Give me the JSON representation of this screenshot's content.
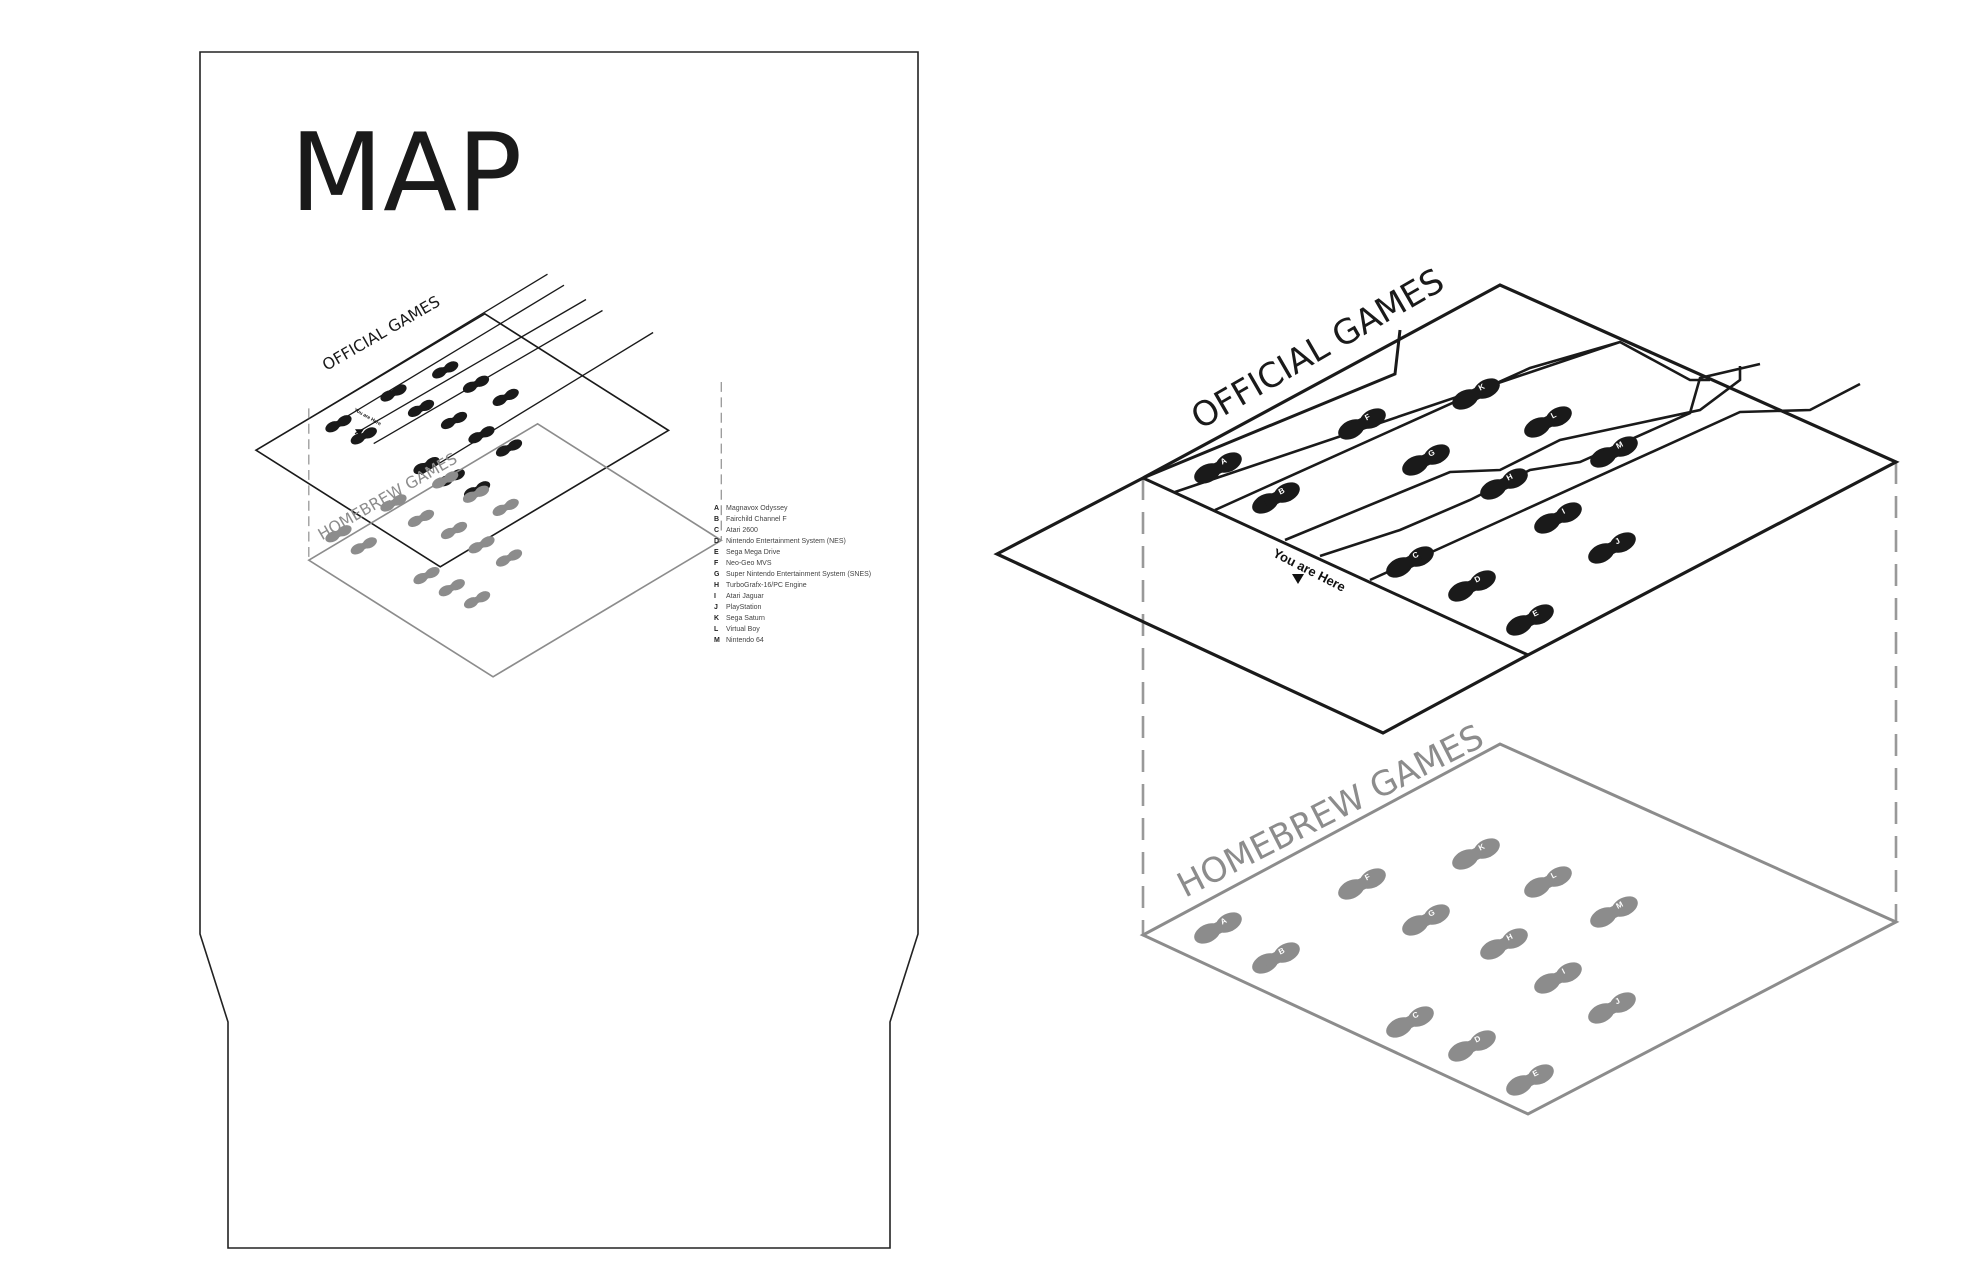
{
  "sign": {
    "title": "MAP"
  },
  "layers": {
    "official": "OFFICIAL GAMES",
    "homebrew": "HOMEBREW GAMES"
  },
  "marker": {
    "label": "You are Here"
  },
  "legend": [
    {
      "letter": "A",
      "name": "Magnavox Odyssey"
    },
    {
      "letter": "B",
      "name": "Fairchild Channel F"
    },
    {
      "letter": "C",
      "name": "Atari 2600"
    },
    {
      "letter": "D",
      "name": "Nintendo Entertainment System (NES)"
    },
    {
      "letter": "E",
      "name": "Sega Mega Drive"
    },
    {
      "letter": "F",
      "name": "Neo-Geo MVS"
    },
    {
      "letter": "G",
      "name": "Super Nintendo Entertainment System (SNES)"
    },
    {
      "letter": "H",
      "name": "TurboGrafx-16/PC Engine"
    },
    {
      "letter": "I",
      "name": "Atari Jaguar"
    },
    {
      "letter": "J",
      "name": "PlayStation"
    },
    {
      "letter": "K",
      "name": "Sega Saturn"
    },
    {
      "letter": "L",
      "name": "Virtual Boy"
    },
    {
      "letter": "M",
      "name": "Nintendo 64"
    }
  ],
  "colors": {
    "official": "#1a1a1a",
    "homebrew": "#8c8c8c",
    "outline": "#222222"
  }
}
